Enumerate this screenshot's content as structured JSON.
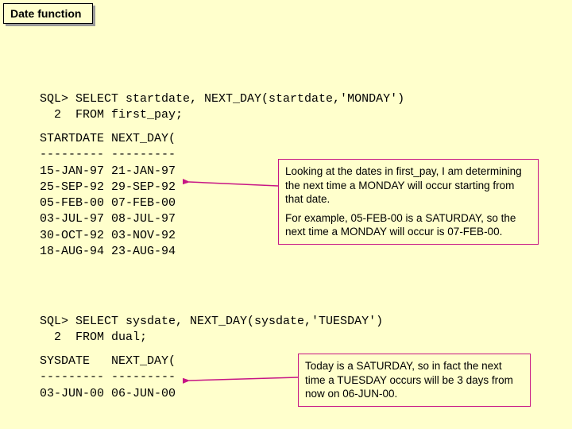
{
  "title": "Date function",
  "query1": "SQL> SELECT startdate, NEXT_DAY(startdate,'MONDAY')\n  2  FROM first_pay;",
  "result1": "STARTDATE NEXT_DAY(\n--------- ---------\n15-JAN-97 21-JAN-97\n25-SEP-92 29-SEP-92\n05-FEB-00 07-FEB-00\n03-JUL-97 08-JUL-97\n30-OCT-92 03-NOV-92\n18-AUG-94 23-AUG-94",
  "note1_p1": "Looking at the dates in first_pay, I am determining the next time a MONDAY will occur starting from that date.",
  "note1_p2": "For example, 05-FEB-00 is a SATURDAY, so the next time a MONDAY will occur is 07-FEB-00.",
  "query2": "SQL> SELECT sysdate, NEXT_DAY(sysdate,'TUESDAY')\n  2  FROM dual;",
  "result2": "SYSDATE   NEXT_DAY(\n--------- ---------\n03-JUN-00 06-JUN-00",
  "note2": "Today is a SATURDAY, so in fact the next time a TUESDAY occurs will be 3 days from now on 06-JUN-00."
}
